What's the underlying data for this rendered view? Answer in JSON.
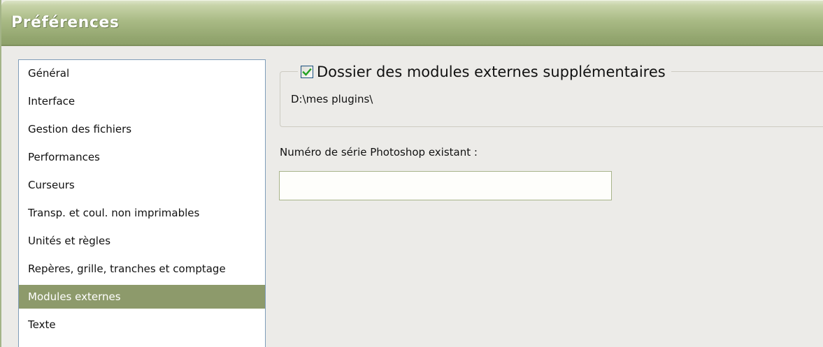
{
  "window": {
    "title": "Préférences"
  },
  "sidebar": {
    "items": [
      {
        "label": "Général",
        "selected": false
      },
      {
        "label": "Interface",
        "selected": false
      },
      {
        "label": "Gestion des fichiers",
        "selected": false
      },
      {
        "label": "Performances",
        "selected": false
      },
      {
        "label": "Curseurs",
        "selected": false
      },
      {
        "label": "Transp. et coul. non imprimables",
        "selected": false
      },
      {
        "label": "Unités et règles",
        "selected": false
      },
      {
        "label": "Repères, grille, tranches et comptage",
        "selected": false
      },
      {
        "label": "Modules externes",
        "selected": true
      },
      {
        "label": "Texte",
        "selected": false
      }
    ]
  },
  "plugins_group": {
    "checkbox_label": "Dossier des modules externes supplémentaires",
    "checked": true,
    "folder_path": "D:\\mes plugins\\"
  },
  "serial": {
    "label": "Numéro de série Photoshop existant :",
    "value": ""
  },
  "colors": {
    "titlebar": "#9fb07b",
    "selection": "#8d9a6b",
    "checkmark": "#21a121"
  },
  "icons": {
    "checkbox": "checkmark-icon"
  }
}
